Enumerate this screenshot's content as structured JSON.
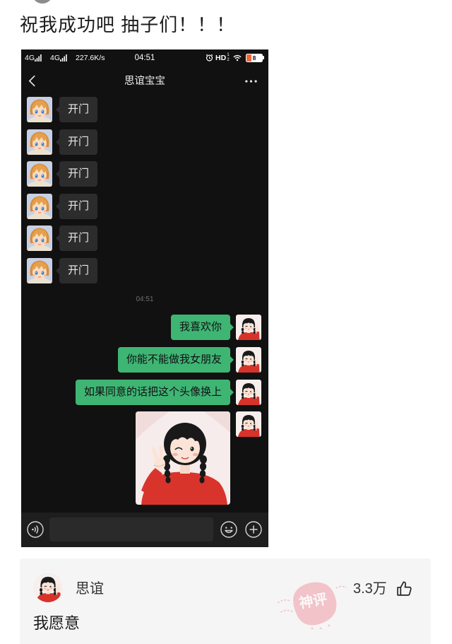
{
  "post": {
    "text": "祝我成功吧 抽子们！！！"
  },
  "chat": {
    "status_bar": {
      "network_1": "4G",
      "network_2": "4G",
      "speed": "227.6K/s",
      "time": "04:51",
      "hd": "HD",
      "hd_sup": "1",
      "hd_sub": "2",
      "battery": "8"
    },
    "header": {
      "title": "思谊宝宝"
    },
    "incoming_messages": [
      "开门",
      "开门",
      "开门",
      "开门",
      "开门",
      "开门"
    ],
    "timestamp": "04:51",
    "outgoing_messages": [
      "我喜欢你",
      "你能不能做我女朋友",
      "如果同意的话把这个头像换上"
    ],
    "input": {
      "value": ""
    },
    "icons": {
      "back": "chevron-left-icon",
      "more": "more-dots-icon",
      "voice": "voice-icon",
      "emoji": "emoji-icon",
      "plus": "plus-icon",
      "alarm": "alarm-icon",
      "wifi": "wifi-icon",
      "signal": "signal-icon"
    }
  },
  "comment": {
    "author": "思谊",
    "likes": "3.3万",
    "text": "我愿意",
    "badge": "神评",
    "icons": {
      "like": "thumbs-up-icon"
    }
  },
  "colors": {
    "chat_bg": "#111111",
    "incoming_bubble": "#2c2c2c",
    "outgoing_bubble": "#3fb574",
    "input_bar": "#1e1e1e",
    "comment_bg": "#f5f5f5",
    "shirt_red": "#d8342c"
  }
}
